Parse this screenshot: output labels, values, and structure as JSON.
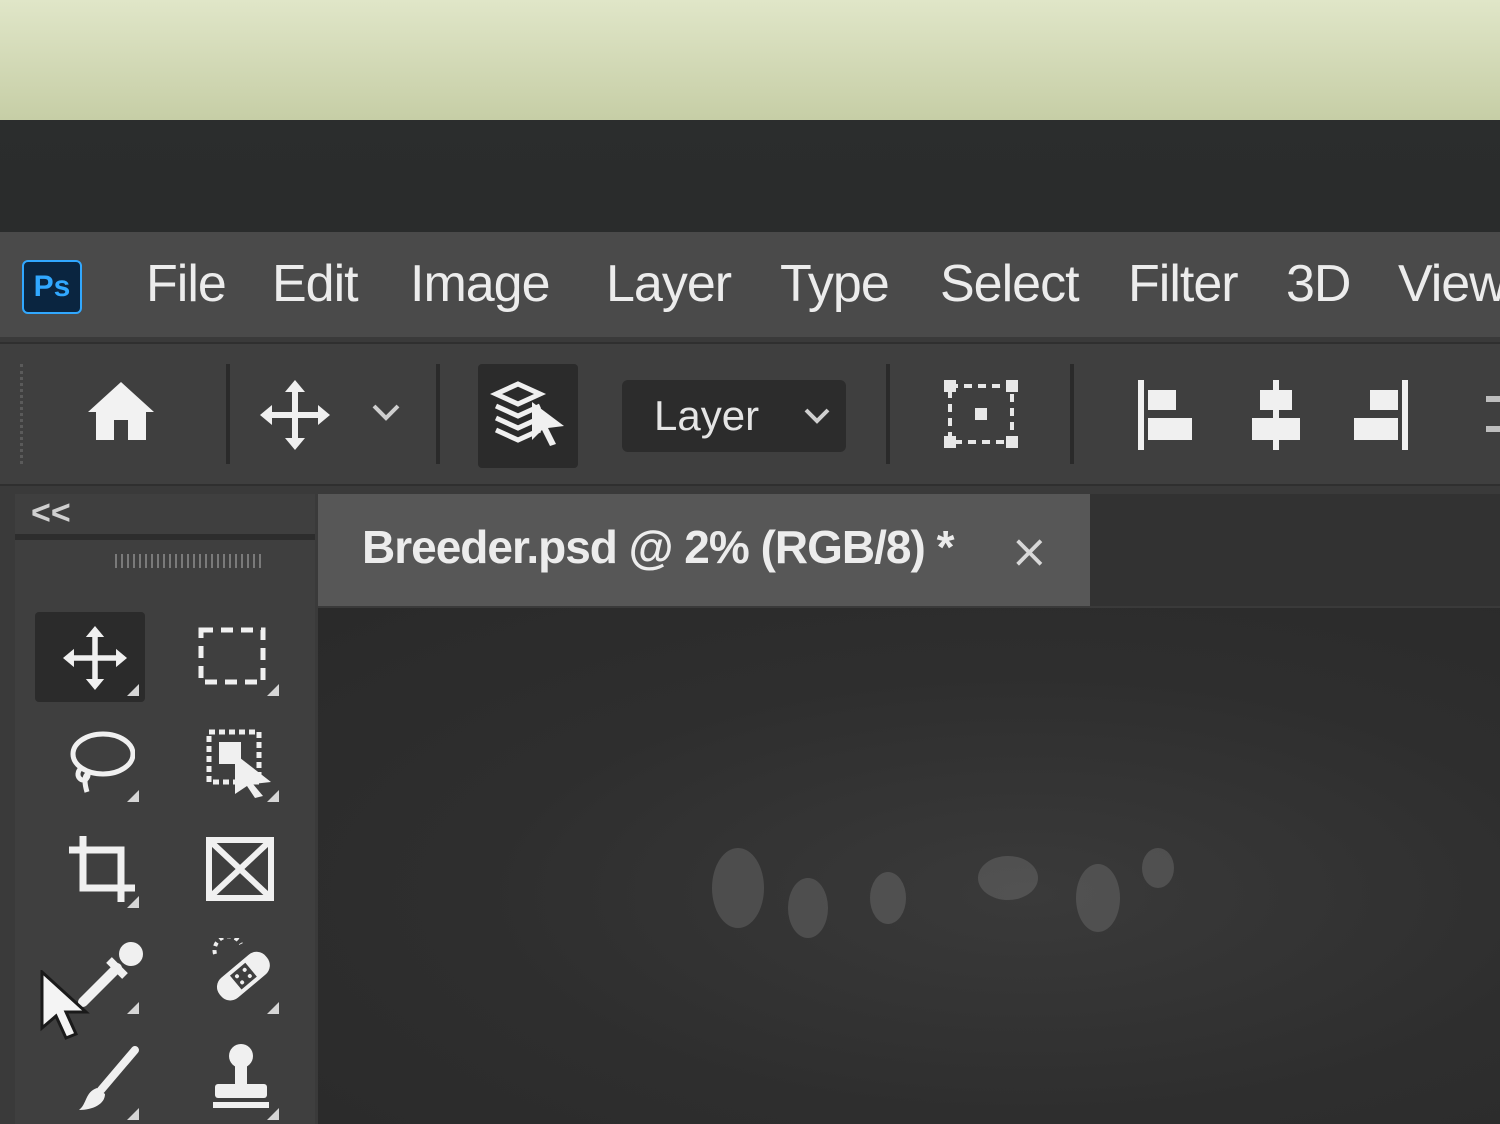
{
  "app": {
    "logo_text": "Ps"
  },
  "menu": {
    "items": [
      {
        "label": "File"
      },
      {
        "label": "Edit"
      },
      {
        "label": "Image"
      },
      {
        "label": "Layer"
      },
      {
        "label": "Type"
      },
      {
        "label": "Select"
      },
      {
        "label": "Filter"
      },
      {
        "label": "3D"
      },
      {
        "label": "View"
      }
    ]
  },
  "options_bar": {
    "home_icon": "home-icon",
    "move_icon": "move-icon",
    "auto_select_icon": "auto-select-layers-icon",
    "auto_select_target": "Layer",
    "transform_controls_icon": "transform-controls-icon",
    "align_icons": [
      "align-left-icon",
      "align-center-icon",
      "align-right-icon"
    ]
  },
  "tool_panel": {
    "collapse_label": "<<",
    "tools": [
      {
        "icon": "move-tool-icon",
        "active": true
      },
      {
        "icon": "rectangular-marquee-icon",
        "active": false
      },
      {
        "icon": "lasso-icon",
        "active": false
      },
      {
        "icon": "object-selection-icon",
        "active": false
      },
      {
        "icon": "crop-icon",
        "active": false
      },
      {
        "icon": "frame-icon",
        "active": false
      },
      {
        "icon": "eyedropper-icon",
        "active": false
      },
      {
        "icon": "spot-healing-icon",
        "active": false
      },
      {
        "icon": "brush-icon",
        "active": false
      },
      {
        "icon": "clone-stamp-icon",
        "active": false
      }
    ]
  },
  "document": {
    "tab_title": "Breeder.psd @ 2% (RGB/8) *",
    "close_glyph": "×"
  },
  "colors": {
    "menubar_bg": "#4a4a4a",
    "panel_bg": "#3f3f3f",
    "ps_logo_bg": "#0a2540",
    "ps_logo_accent": "#31a8ff"
  }
}
